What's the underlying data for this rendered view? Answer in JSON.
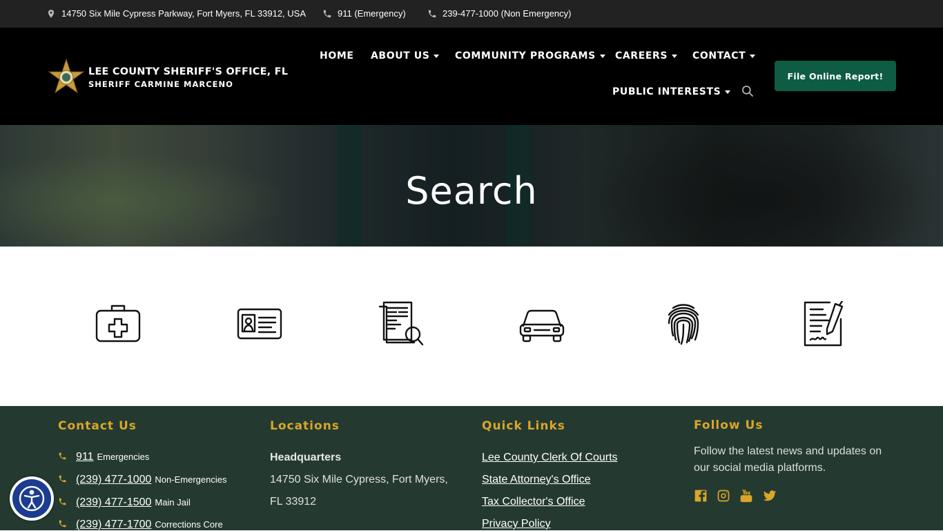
{
  "topbar": {
    "address": "14750 Six Mile Cypress Parkway, Fort Myers, FL 33912, USA",
    "emergency": "911 (Emergency)",
    "non_emergency": "239-477-1000 (Non Emergency)"
  },
  "header": {
    "title": "LEE COUNTY SHERIFF'S OFFICE, FL",
    "subtitle": "SHERIFF CARMINE MARCENO",
    "nav": {
      "home": "HOME",
      "about": "ABOUT US",
      "community": "COMMUNITY PROGRAMS",
      "careers": "CAREERS",
      "contact": "CONTACT",
      "public": "PUBLIC INTERESTS"
    },
    "report_button": "File Online Report!"
  },
  "hero": {
    "title": "Search"
  },
  "services_icons": [
    "first-aid-kit-icon",
    "id-card-icon",
    "document-search-icon",
    "car-icon",
    "fingerprint-icon",
    "signed-document-icon"
  ],
  "footer": {
    "contact": {
      "title": "Contact Us",
      "rows": [
        {
          "number": "911",
          "label": "Emergencies"
        },
        {
          "number": "(239) 477-1000",
          "label": "Non-Emergencies"
        },
        {
          "number": "(239) 477-1500",
          "label": "Main Jail"
        },
        {
          "number": "(239) 477-1700",
          "label": "Corrections Core"
        }
      ]
    },
    "locations": {
      "title": "Locations",
      "hq_label": "Headquarters",
      "line1": "14750 Six Mile Cypress, Fort Myers,",
      "line2": "FL 33912"
    },
    "quick_links": {
      "title": "Quick Links",
      "links": [
        "Lee County Clerk Of Courts",
        "State Attorney's Office",
        "Tax Collector's Office",
        "Privacy Policy"
      ]
    },
    "follow": {
      "title": "Follow Us",
      "text": "Follow the latest news and updates on our social media platforms.",
      "icons": [
        "facebook-icon",
        "instagram-icon",
        "youtube-icon",
        "twitter-icon"
      ]
    }
  },
  "colors": {
    "accent_gold": "#d9a62a",
    "footer_bg": "#243a30",
    "button_green": "#0f5c44"
  }
}
